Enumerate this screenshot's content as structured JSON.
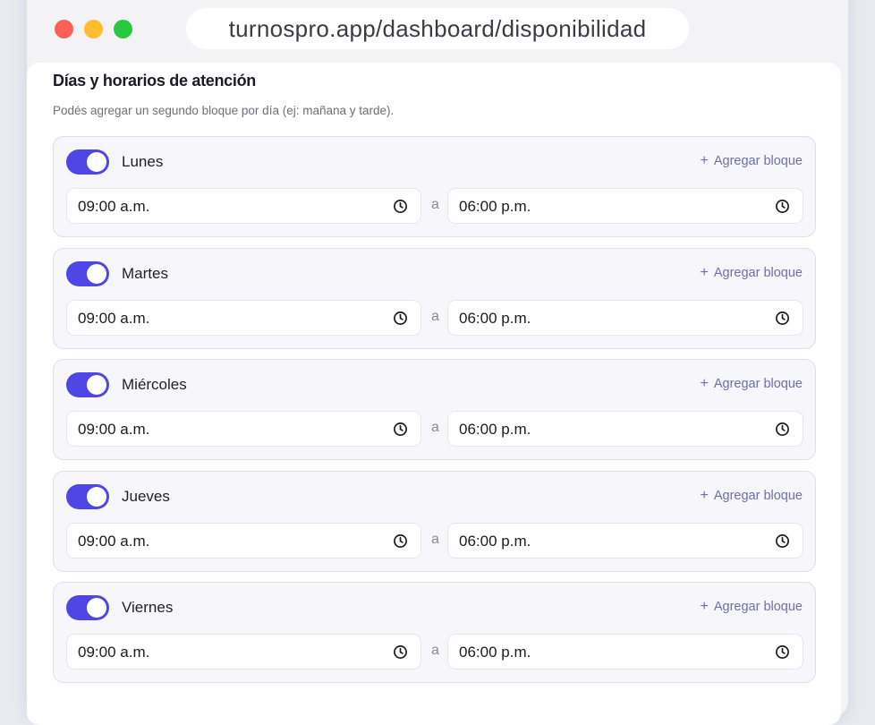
{
  "browser": {
    "url": "turnospro.app/dashboard/disponibilidad"
  },
  "section": {
    "title": "Días y horarios de atención",
    "subtitle": "Podés agregar un segundo bloque por día (ej: mañana y tarde)."
  },
  "labels": {
    "add_block": "Agregar bloque",
    "separator": "a"
  },
  "days": [
    {
      "name": "Lunes",
      "enabled": true,
      "from": "09:00 a.m.",
      "to": "06:00 p.m."
    },
    {
      "name": "Martes",
      "enabled": true,
      "from": "09:00 a.m.",
      "to": "06:00 p.m."
    },
    {
      "name": "Miércoles",
      "enabled": true,
      "from": "09:00 a.m.",
      "to": "06:00 p.m."
    },
    {
      "name": "Jueves",
      "enabled": true,
      "from": "09:00 a.m.",
      "to": "06:00 p.m."
    },
    {
      "name": "Viernes",
      "enabled": true,
      "from": "09:00 a.m.",
      "to": "06:00 p.m."
    }
  ],
  "colors": {
    "accent": "#4f46e5",
    "add_block_text": "#6e6eb0"
  },
  "icons": {
    "time_field": "clock-icon",
    "add_block": "plus-icon"
  }
}
